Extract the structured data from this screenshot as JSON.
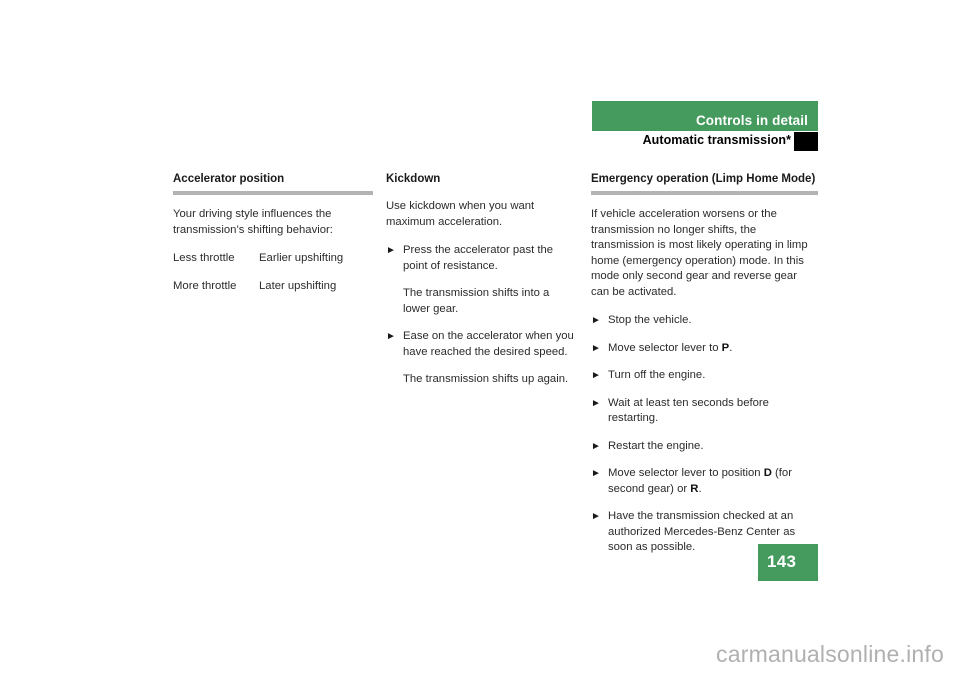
{
  "header": {
    "band_title": "Controls in detail",
    "section_title": "Automatic transmission*",
    "band_color": "#459b5e",
    "marker_color": "#000000"
  },
  "columns": [
    {
      "id": "accelerator-position",
      "title": "Accelerator position",
      "has_rule": true,
      "intro": "Your driving style influences the transmission’s shifting behavior:",
      "table": {
        "rows": [
          {
            "key": "Less throttle",
            "value": "Earlier upshifting"
          },
          {
            "key": "More throttle",
            "value": "Later upshifting"
          }
        ]
      }
    },
    {
      "id": "kickdown",
      "title": "Kickdown",
      "has_rule": false,
      "intro": "Use kickdown when you want maximum acceleration.",
      "steps": [
        {
          "marker": "triangle-right-bullet",
          "text": "Press the accelerator past the point of resistance.",
          "result": "The transmission shifts into a lower gear."
        },
        {
          "marker": "triangle-right-bullet",
          "text": "Ease on the accelerator when you have reached the desired speed.",
          "result": "The transmission shifts up again."
        }
      ]
    },
    {
      "id": "emergency-operation",
      "title": "Emergency operation (Limp Home Mode)",
      "has_rule": true,
      "intro": "If vehicle acceleration worsens or the transmission no longer shifts, the transmission is most likely operating in limp home (emergency operation) mode. In this mode only second gear and reverse gear can be activated.",
      "steps": [
        {
          "marker": "triangle-right-bullet",
          "text": "Stop the vehicle."
        },
        {
          "marker": "triangle-right-bullet",
          "text_html": "Move selector lever to <b>P</b>."
        },
        {
          "marker": "triangle-right-bullet",
          "text": "Turn off the engine."
        },
        {
          "marker": "triangle-right-bullet",
          "text": "Wait at least ten seconds before restarting."
        },
        {
          "marker": "triangle-right-bullet",
          "text": "Restart the engine."
        },
        {
          "marker": "triangle-right-bullet",
          "text_html": "Move selector lever to position <b>D</b> (for second gear) or <b>R</b>."
        },
        {
          "marker": "triangle-right-bullet",
          "text": "Have the transmission checked at an authorized Mercedes-Benz Center as soon as possible."
        }
      ]
    }
  ],
  "footer": {
    "page_number": "143",
    "watermark": "carmanualsonline.info"
  },
  "glyphs": {
    "bullet": "►"
  }
}
